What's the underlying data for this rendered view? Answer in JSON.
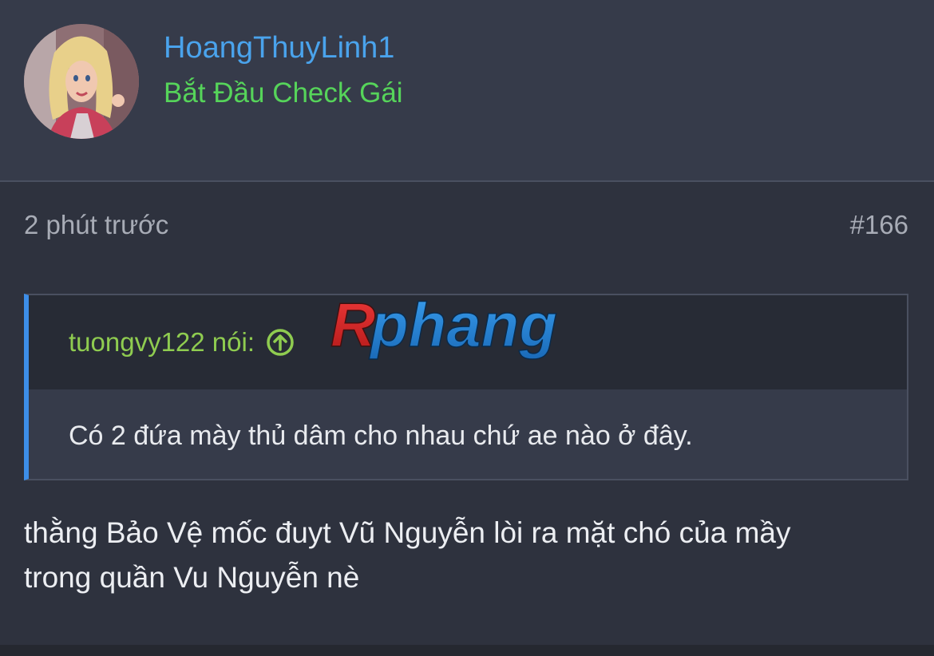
{
  "user": {
    "username": "HoangThuyLinh1",
    "title": "Bắt Đầu Check Gái"
  },
  "post": {
    "time": "2 phút trước",
    "number": "#166",
    "quote": {
      "author": "tuongvy122 nói:",
      "text": "Có 2 đứa mày thủ dâm cho nhau chứ ae nào ở đây."
    },
    "text_line1": "thằng Bảo Vệ mốc đuyt Vũ Nguyễn lòi ra mặt chó của mầy",
    "text_line2": "trong quần Vu Nguyễn nè"
  },
  "watermark": {
    "text": "Rphang"
  },
  "colors": {
    "username": "#4aa3ec",
    "user_title": "#56d45a",
    "quote_author": "#8fcc50",
    "quote_border": "#3d8ee8"
  },
  "icons": {
    "avatar": "avatar",
    "quote_jump": "arrow-up-circle-icon"
  }
}
